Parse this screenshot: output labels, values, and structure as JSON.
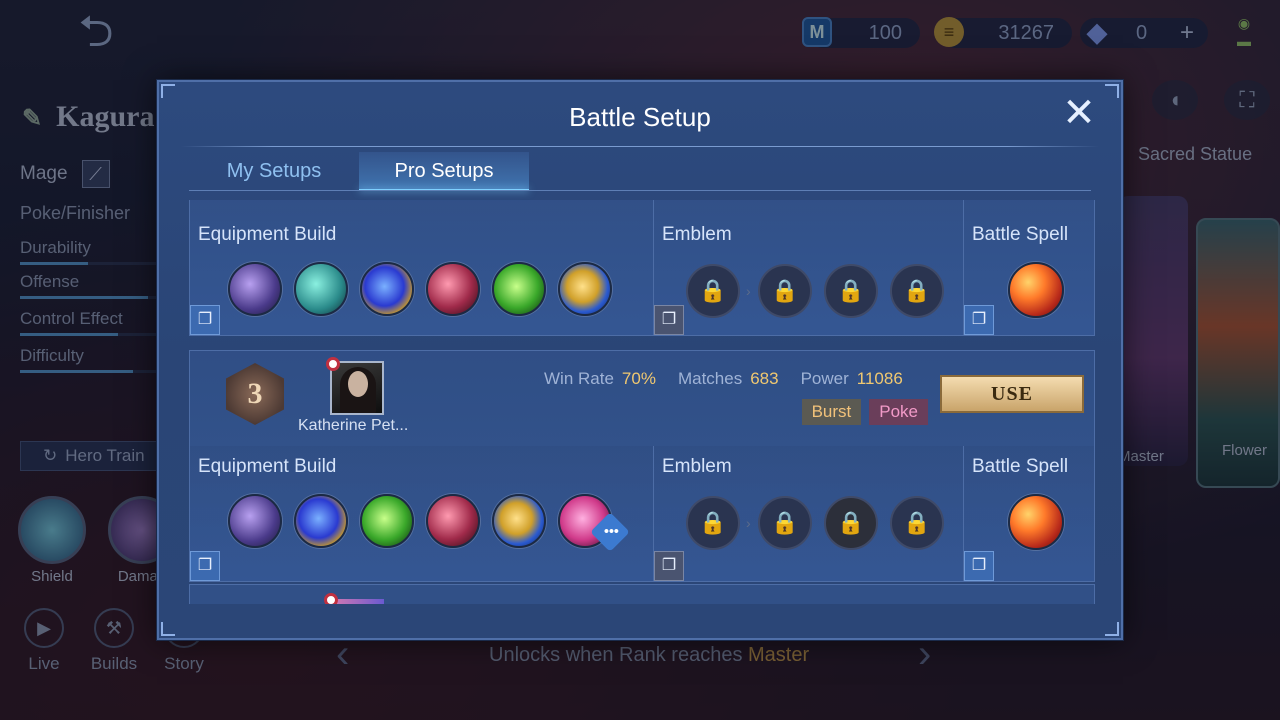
{
  "header": {
    "currencies": [
      {
        "name": "tickets",
        "icon": "m-ticket-icon",
        "value": "100"
      },
      {
        "name": "battle_points",
        "icon": "coin-stack-icon",
        "value": "31267"
      },
      {
        "name": "diamonds",
        "icon": "diamond-icon",
        "value": "0"
      }
    ]
  },
  "hero": {
    "name": "Kagura",
    "role": "Mage",
    "tag": "Poke/Finisher",
    "stats": [
      {
        "label": "Durability",
        "value": 0.45
      },
      {
        "label": "Offense",
        "value": 0.85
      },
      {
        "label": "Control Effect",
        "value": 0.65
      },
      {
        "label": "Difficulty",
        "value": 0.75
      }
    ],
    "train_label": "Hero Train",
    "skills": [
      "Shield",
      "Damag"
    ]
  },
  "bottom_nav": [
    "Live",
    "Builds",
    "Story"
  ],
  "right_panel": {
    "tab_label": "Sacred Statue",
    "skin_labels": [
      "Master",
      "Flower"
    ],
    "unlock_prefix": "Unlocks when Rank reaches ",
    "unlock_rank": "Master"
  },
  "modal": {
    "title": "Battle Setup",
    "tabs": [
      {
        "label": "My Setups",
        "active": false
      },
      {
        "label": "Pro Setups",
        "active": true
      }
    ],
    "section_titles": {
      "equipment": "Equipment Build",
      "emblem": "Emblem",
      "spell": "Battle Spell"
    },
    "builds": [
      {
        "items": [
          "boots-icon",
          "staff-icon",
          "orb-icon",
          "wand-icon",
          "crystal-icon",
          "trident-icon"
        ],
        "emblems": [
          "locked-talent-icon",
          "locked-talent-icon",
          "locked-talent-icon",
          "locked-talent-icon"
        ],
        "spell": "flameshot-icon"
      },
      {
        "pro": {
          "rank": "3",
          "name": "Katherine Pet...",
          "win_rate_label": "Win Rate",
          "win_rate": "70%",
          "matches_label": "Matches",
          "matches": "683",
          "power_label": "Power",
          "power": "11086",
          "tags": [
            "Burst",
            "Poke"
          ],
          "use_label": "USE"
        },
        "items": [
          "boots-icon",
          "orb-icon",
          "crystal-icon",
          "wand-icon",
          "trident-icon",
          "pink-orb-icon"
        ],
        "emblems": [
          "locked-talent-icon",
          "locked-talent-icon",
          "locked-talent-icon",
          "locked-talent-icon"
        ],
        "spell": "flameshot-icon"
      }
    ]
  },
  "colors": {
    "modal_bg": "#2b4677",
    "accent_gold": "#f0c870",
    "use_button": "#e6c88e",
    "tab_highlight": "#7fd0ff"
  }
}
